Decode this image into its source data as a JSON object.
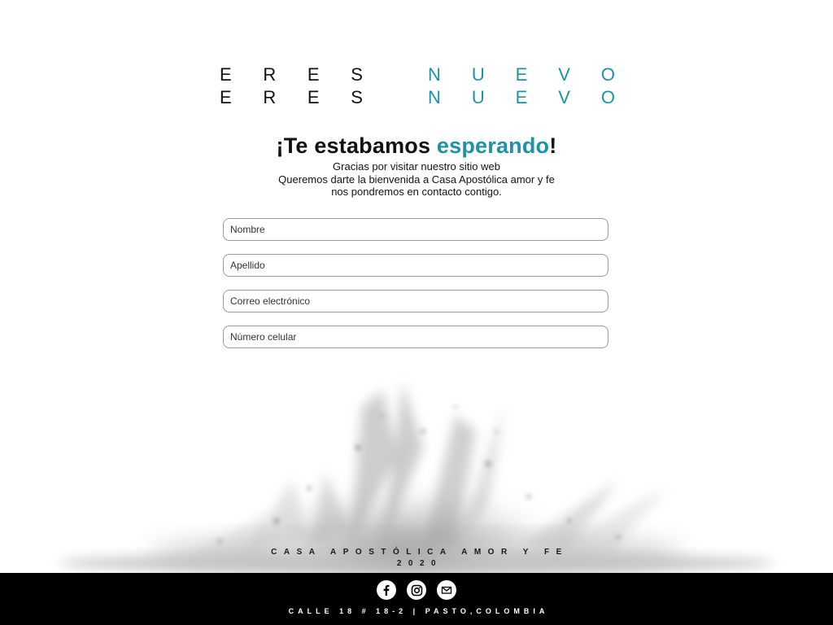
{
  "hero": {
    "line1": {
      "left": [
        "E",
        "R",
        "E",
        "S"
      ],
      "right": [
        "N",
        "U",
        "E",
        "V",
        "O"
      ]
    },
    "line2": {
      "left": [
        "E",
        "R",
        "E",
        "S"
      ],
      "right": [
        "N",
        "U",
        "E",
        "V",
        "O"
      ]
    }
  },
  "welcome": {
    "title_prefix": "¡Te estabamos ",
    "title_accent": "esperando",
    "title_suffix": "!",
    "lines": [
      "Gracias por visitar nuestro sitio web",
      "Queremos darte la bienvenida a Casa Apostólica amor y fe",
      "nos pondremos en contacto contigo."
    ]
  },
  "form": {
    "nombre_placeholder": "Nombre",
    "apellido_placeholder": "Apellido",
    "correo_placeholder": "Correo electrónico",
    "celular_placeholder": "Número celular"
  },
  "tagline": {
    "line1": "CASA APOSTÓLICA AMOR Y FE",
    "line2": "2020"
  },
  "footer": {
    "icons": [
      "facebook-icon",
      "instagram-icon",
      "mail-icon"
    ],
    "address": "CALLE 18 # 18-2 | PASTO,COLOMBIA"
  },
  "colors": {
    "accent": "#1f93a6",
    "text": "#111111",
    "footer_bg": "#000000"
  }
}
